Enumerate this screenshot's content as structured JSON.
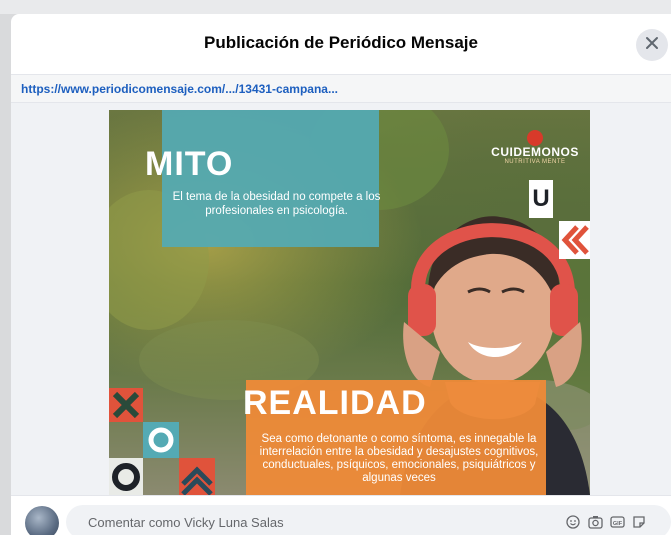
{
  "modal": {
    "title": "Publicación de Periódico Mensaje",
    "url": "https://www.periodicomensaje.com/.../13431-campana...",
    "close_icon": "close-icon"
  },
  "poster": {
    "mito_title": "MITO",
    "mito_text": "El tema de la obesidad no compete a los profesionales en psicología.",
    "brand_name": "CUIDEMONOS",
    "brand_tag": "NUTRITIVA MENTE",
    "realidad_title": "REALIDAD",
    "realidad_text": "Sea como detonante o como síntoma, es innegable la interrelación entre la obesidad y desajustes cognitivos, conductuales, psíquicos, emocionales, psiquiátricos y algunas veces",
    "colors": {
      "teal": "#54aab4",
      "orange": "#ee8a38",
      "red": "#e0533b"
    }
  },
  "footer": {
    "comment_placeholder": "Comentar como Vicky Luna Salas",
    "icons": [
      "emoji-icon",
      "camera-icon",
      "gif-icon",
      "sticker-icon"
    ]
  }
}
